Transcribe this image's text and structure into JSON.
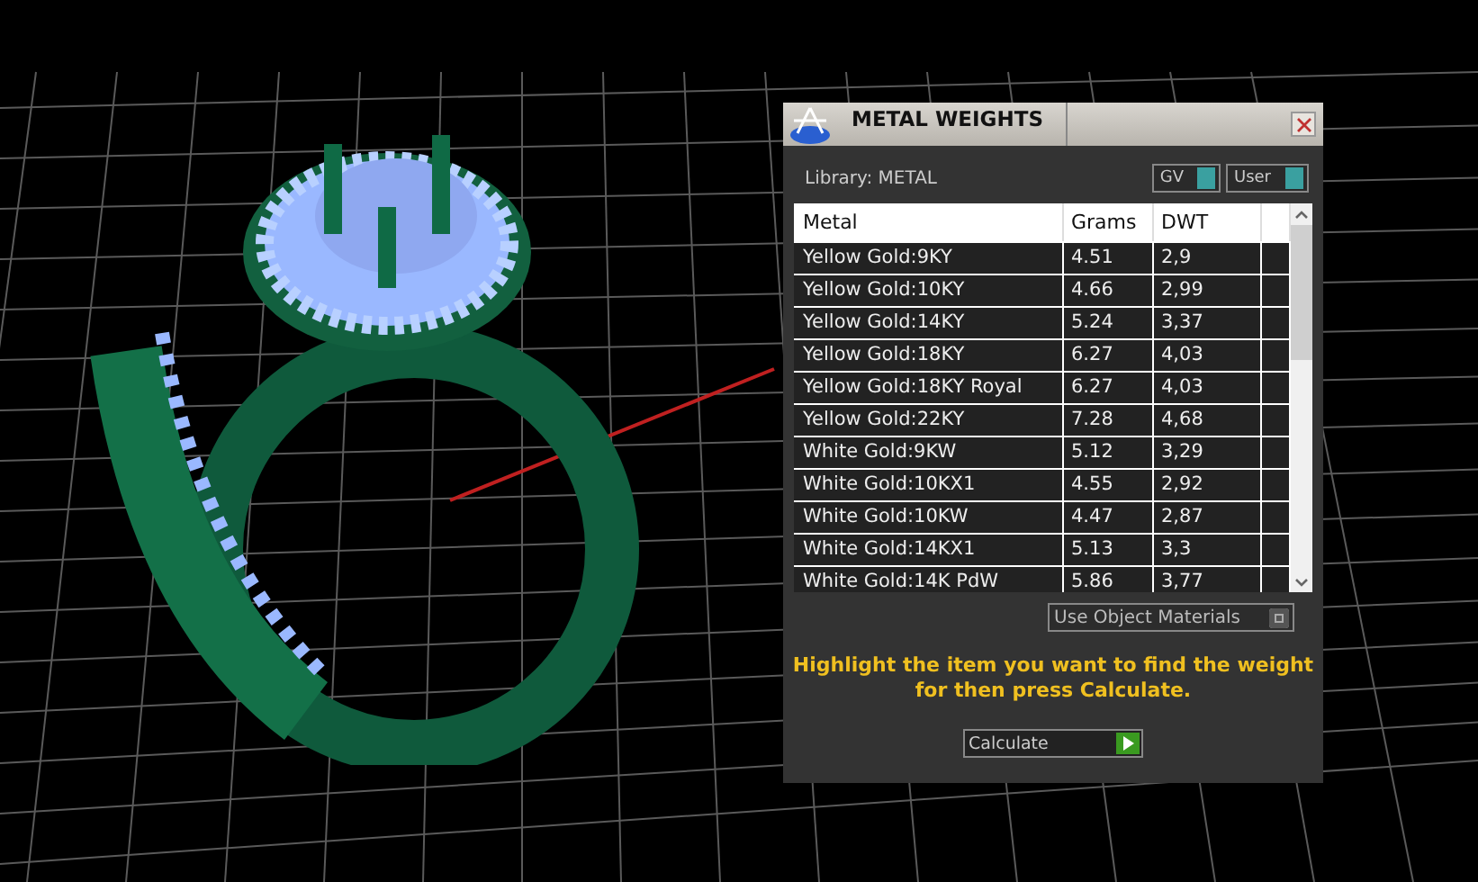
{
  "panel": {
    "title": "METAL WEIGHTS",
    "library_label": "Library: METAL",
    "dropdowns": [
      {
        "label": "GV"
      },
      {
        "label": "User"
      }
    ],
    "table": {
      "columns": [
        "Metal",
        "Grams",
        "DWT"
      ],
      "rows": [
        {
          "metal": "Yellow Gold:9KY",
          "grams": "4.51",
          "dwt": "2,9"
        },
        {
          "metal": "Yellow Gold:10KY",
          "grams": "4.66",
          "dwt": "2,99"
        },
        {
          "metal": "Yellow Gold:14KY",
          "grams": "5.24",
          "dwt": "3,37"
        },
        {
          "metal": "Yellow Gold:18KY",
          "grams": "6.27",
          "dwt": "4,03"
        },
        {
          "metal": "Yellow Gold:18KY Royal",
          "grams": "6.27",
          "dwt": "4,03"
        },
        {
          "metal": "Yellow Gold:22KY",
          "grams": "7.28",
          "dwt": "4,68"
        },
        {
          "metal": "White Gold:9KW",
          "grams": "5.12",
          "dwt": "3,29"
        },
        {
          "metal": "White Gold:10KX1",
          "grams": "4.55",
          "dwt": "2,92"
        },
        {
          "metal": "White Gold:10KW",
          "grams": "4.47",
          "dwt": "2,87"
        },
        {
          "metal": "White Gold:14KX1",
          "grams": "5.13",
          "dwt": "3,3"
        },
        {
          "metal": "White Gold:14K PdW",
          "grams": "5.86",
          "dwt": "3,77"
        }
      ]
    },
    "use_object_materials": {
      "label": "Use Object Materials",
      "checked": false
    },
    "instruction": "Highlight the item you want to find the weight for then press Calculate.",
    "calculate_button": "Calculate"
  }
}
